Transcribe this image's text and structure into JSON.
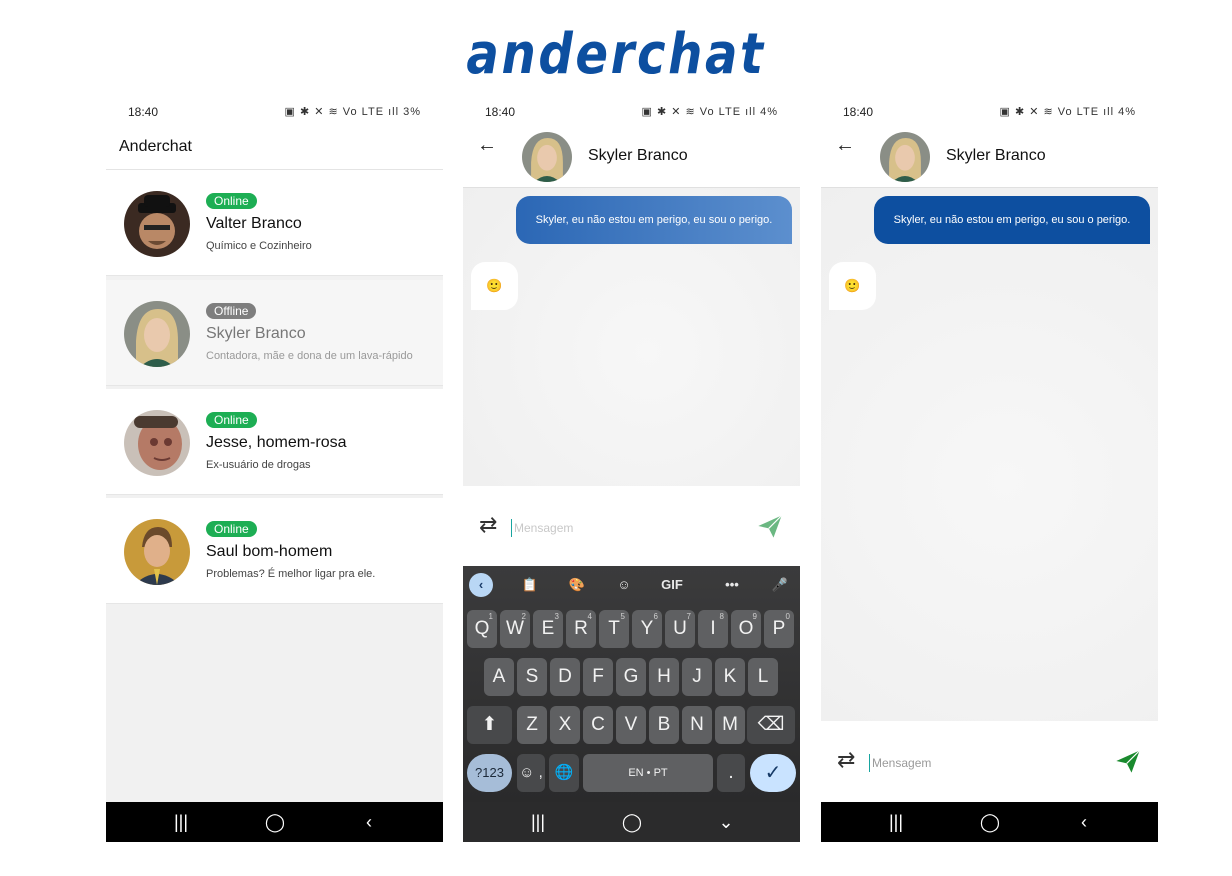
{
  "brand": {
    "logo_text": "anderchat"
  },
  "status": {
    "p1": {
      "time": "18:40",
      "icons": "▣ ✱ ✕ ≋ Vo LTE ıll",
      "battery": "3%"
    },
    "p2": {
      "time": "18:40",
      "icons": "▣ ✱ ✕ ≋ Vo LTE ıll",
      "battery": "4%"
    },
    "p3": {
      "time": "18:40",
      "icons": "▣ ✱ ✕ ≋ Vo LTE ıll",
      "battery": "4%"
    }
  },
  "list_screen": {
    "app_title": "Anderchat",
    "contacts": [
      {
        "status": "Online",
        "name": "Valter Branco",
        "description": "Químico e Cozinheiro"
      },
      {
        "status": "Offline",
        "name": "Skyler Branco",
        "description": "Contadora, mãe e dona de um lava-rápido"
      },
      {
        "status": "Online",
        "name": "Jesse, homem-rosa",
        "description": "Ex-usuário de drogas"
      },
      {
        "status": "Online",
        "name": "Saul bom-homem",
        "description": "Problemas? É melhor ligar pra ele."
      }
    ]
  },
  "chat": {
    "contact_name": "Skyler Branco",
    "outgoing_message": "Skyler, eu não estou em perigo, eu sou o perigo.",
    "incoming_message": "🙂",
    "input_placeholder": "Mensagem",
    "back_glyph": "←",
    "swap_glyph": "⇄"
  },
  "keyboard": {
    "toolbar": [
      "‹",
      "📋",
      "🎨",
      "☺",
      "GIF",
      "•••",
      "🎤"
    ],
    "row1": [
      {
        "key": "Q",
        "hint": "1"
      },
      {
        "key": "W",
        "hint": "2"
      },
      {
        "key": "E",
        "hint": "3"
      },
      {
        "key": "R",
        "hint": "4"
      },
      {
        "key": "T",
        "hint": "5"
      },
      {
        "key": "Y",
        "hint": "6"
      },
      {
        "key": "U",
        "hint": "7"
      },
      {
        "key": "I",
        "hint": "8"
      },
      {
        "key": "O",
        "hint": "9"
      },
      {
        "key": "P",
        "hint": "0"
      }
    ],
    "row2": [
      "A",
      "S",
      "D",
      "F",
      "G",
      "H",
      "J",
      "K",
      "L"
    ],
    "row3": [
      "Z",
      "X",
      "C",
      "V",
      "B",
      "N",
      "M"
    ],
    "shift": "⬆",
    "backspace": "⌫",
    "symbols": "?123",
    "emoji_comma": "☺ ,",
    "globe": "🌐",
    "space": "EN • PT",
    "period": ".",
    "enter": "✓"
  },
  "nav": {
    "recents": "|||",
    "home": "◯",
    "back": "‹",
    "hide_keyboard": "⌄"
  },
  "colors": {
    "brand": "#0d4fa0",
    "online": "#1dae54",
    "offline": "#7e7e7e",
    "send_p2": "#6bb882",
    "send_p3": "#1a8a2e"
  }
}
